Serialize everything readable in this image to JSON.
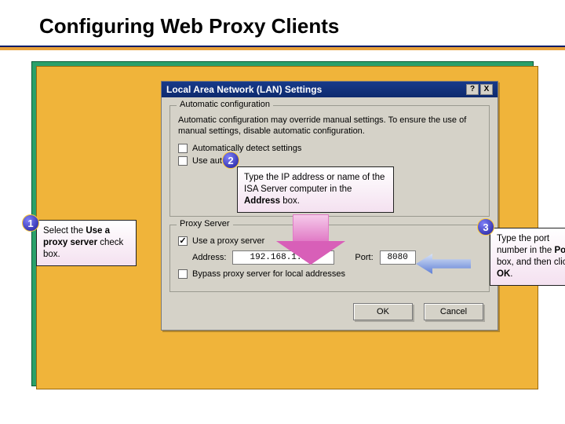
{
  "title": "Configuring Web Proxy Clients",
  "dialog": {
    "title": "Local Area Network (LAN) Settings",
    "help_btn": "?",
    "close_btn": "X",
    "group_auto": {
      "label": "Automatic configuration",
      "desc": "Automatic configuration may override manual settings. To ensure the use of manual settings, disable automatic configuration.",
      "auto_detect": "Automatically detect settings",
      "use_script_prefix": "Use auto"
    },
    "group_proxy": {
      "label": "Proxy Server",
      "use_proxy": "Use a proxy server",
      "address_label": "Address:",
      "address_value": "192.168.1.200",
      "port_label": "Port:",
      "port_value": "8080",
      "bypass": "Bypass proxy server for local addresses"
    },
    "ok": "OK",
    "cancel": "Cancel"
  },
  "steps": {
    "n1": "1",
    "n2": "2",
    "n3": "3",
    "t1_a": "Select the ",
    "t1_b": "Use a proxy server",
    "t1_c": " check box.",
    "t2_a": "Type the IP address or name of the ISA Server computer in the ",
    "t2_b": "Address",
    "t2_c": " box.",
    "t3_a": "Type the port number in the ",
    "t3_b": "Port",
    "t3_c": " box, and then click ",
    "t3_d": "OK",
    "t3_e": "."
  }
}
